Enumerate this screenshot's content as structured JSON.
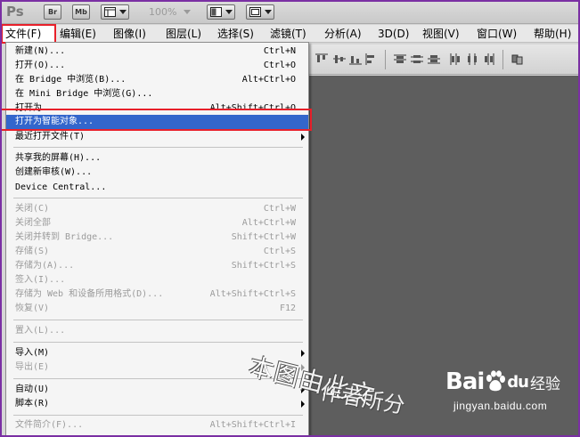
{
  "appbar": {
    "logo": "Ps",
    "bridge_btn": "Br",
    "minibridge_btn": "Mb",
    "zoom": "100%"
  },
  "menubar": {
    "items": [
      {
        "label": "文件(F)",
        "active": true
      },
      {
        "label": "编辑(E)"
      },
      {
        "label": "图像(I)"
      },
      {
        "label": "图层(L)"
      },
      {
        "label": "选择(S)"
      },
      {
        "label": "滤镜(T)"
      },
      {
        "label": "分析(A)"
      },
      {
        "label": "3D(D)"
      },
      {
        "label": "视图(V)"
      },
      {
        "label": "窗口(W)"
      },
      {
        "label": "帮助(H)"
      }
    ]
  },
  "file_menu": {
    "items": [
      {
        "label": "新建(N)...",
        "shortcut": "Ctrl+N"
      },
      {
        "label": "打开(O)...",
        "shortcut": "Ctrl+O"
      },
      {
        "label": "在 Bridge 中浏览(B)...",
        "shortcut": "Alt+Ctrl+O"
      },
      {
        "label": "在 Mini Bridge 中浏览(G)...",
        "shortcut": ""
      },
      {
        "label": "打开为...",
        "shortcut": "Alt+Shift+Ctrl+O"
      },
      {
        "label": "打开为智能对象...",
        "shortcut": "",
        "selected": true
      },
      {
        "label": "最近打开文件(T)",
        "shortcut": "",
        "submenu": true
      },
      {
        "label": "共享我的屏幕(H)...",
        "shortcut": ""
      },
      {
        "label": "创建新审核(W)...",
        "shortcut": ""
      },
      {
        "label": "Device Central...",
        "shortcut": ""
      },
      {
        "label": "关闭(C)",
        "shortcut": "Ctrl+W",
        "disabled": true
      },
      {
        "label": "关闭全部",
        "shortcut": "Alt+Ctrl+W",
        "disabled": true
      },
      {
        "label": "关闭并转到 Bridge...",
        "shortcut": "Shift+Ctrl+W",
        "disabled": true
      },
      {
        "label": "存储(S)",
        "shortcut": "Ctrl+S",
        "disabled": true
      },
      {
        "label": "存储为(A)...",
        "shortcut": "Shift+Ctrl+S",
        "disabled": true
      },
      {
        "label": "签入(I)...",
        "shortcut": "",
        "disabled": true
      },
      {
        "label": "存储为 Web 和设备所用格式(D)...",
        "shortcut": "Alt+Shift+Ctrl+S",
        "disabled": true
      },
      {
        "label": "恢复(V)",
        "shortcut": "F12",
        "disabled": true
      },
      {
        "label": "置入(L)...",
        "shortcut": "",
        "disabled": true
      },
      {
        "label": "导入(M)",
        "shortcut": "",
        "submenu": true
      },
      {
        "label": "导出(E)",
        "shortcut": "",
        "submenu": true,
        "disabled": true
      },
      {
        "label": "自动(U)",
        "shortcut": "",
        "submenu": true
      },
      {
        "label": "脚本(R)",
        "shortcut": "",
        "submenu": true
      },
      {
        "label": "文件简介(F)...",
        "shortcut": "Alt+Shift+Ctrl+I",
        "disabled": true
      }
    ]
  },
  "watermark": {
    "script_line1": "本图由此文",
    "script_line2": "作者所分",
    "logo_bai": "Bai",
    "logo_du": "du",
    "logo_jingyan": "经验",
    "url": "jingyan.baidu.com"
  },
  "colors": {
    "highlight": "#3366cc",
    "annotation_red": "#e8202a",
    "canvas_gray": "#5e5e5e",
    "window_border": "#7a2fa3"
  }
}
